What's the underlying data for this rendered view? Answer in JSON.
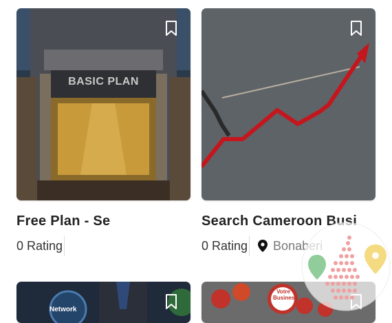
{
  "cards": [
    {
      "title": "Free Plan - Se",
      "rating": "0 Rating",
      "image_text": "BASIC PLAN",
      "bookmark_icon": "bookmark-icon"
    },
    {
      "title": "Search Cameroon Busi",
      "rating": "0 Rating",
      "location": "Bonaberi",
      "location_icon": "map-pin-icon",
      "bookmark_icon": "bookmark-icon"
    },
    {
      "image_text": "Network",
      "bookmark_icon": "bookmark-icon"
    },
    {
      "image_text": "Votre Business",
      "bookmark_icon": "bookmark-icon"
    }
  ],
  "colors": {
    "title": "#222222",
    "meta": "#333333",
    "location": "#777777",
    "arrow_red": "#c4161c"
  }
}
